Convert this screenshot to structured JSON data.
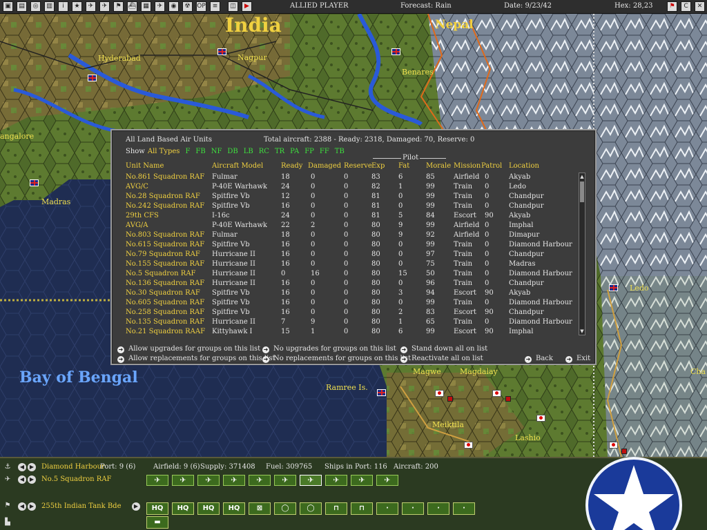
{
  "topbar": {
    "icons": [
      "layout-icon",
      "document-icon",
      "target-icon",
      "report-icon",
      "info-icon",
      "star-icon",
      "ship-icon",
      "plane-icon",
      "flag-icon",
      "warship-icon",
      "map-icon",
      "airfield-icon",
      "globe-icon",
      "radar-icon",
      "op-icon",
      "list-icon",
      "camera-icon",
      "end-turn-icon"
    ],
    "icon_glyphs": [
      "▣",
      "▤",
      "◎",
      "▥",
      "i",
      "★",
      "✈",
      "✈",
      "⚑",
      "⛴",
      "▦",
      "✈",
      "◉",
      "☢",
      "OP",
      "≡",
      "◫",
      "▶"
    ],
    "player": "ALLIED PLAYER",
    "forecast": "Forecast: Rain",
    "date": "Date: 9/23/42",
    "hex": "Hex: 28,23",
    "right_buttons": [
      "⚑",
      "C",
      "✕"
    ]
  },
  "map": {
    "labels": {
      "india": "India",
      "nepal": "Nepal",
      "hyderabad": "Hyderabad",
      "nagpur": "Nagpur",
      "benares": "Benares",
      "bangalore": "angalore",
      "madras": "Madras",
      "bay_of_bengal": "Bay of Bengal",
      "ramree": "Ramree Is.",
      "magwe": "Magwe",
      "magdalay": "Magdalay",
      "meiktila": "Meiktila",
      "lashio": "Lashio",
      "ledo": "Ledo",
      "cha": "Cha"
    }
  },
  "dialog": {
    "title": "All Land Based Air Units",
    "totals": "Total aircraft: 2388 - Ready: 2318, Damaged: 70, Reserve: 0",
    "show_label": "Show",
    "filters": [
      "All Types",
      "F",
      "FB",
      "NF",
      "DB",
      "LB",
      "RC",
      "TR",
      "PA",
      "FP",
      "FF",
      "TB"
    ],
    "pilot_header": "Pilot",
    "columns": [
      "Unit Name",
      "Aircraft Model",
      "Ready",
      "Damaged",
      "Reserve",
      "Exp",
      "Fat",
      "Morale",
      "Mission",
      "Patrol",
      "Location"
    ],
    "rows": [
      [
        "No.861 Squadron RAF",
        "Fulmar",
        "18",
        "0",
        "0",
        "83",
        "6",
        "85",
        "Airfield",
        "0",
        "Akyab"
      ],
      [
        "AVG/C",
        "P-40E Warhawk",
        "24",
        "0",
        "0",
        "82",
        "1",
        "99",
        "Train",
        "0",
        "Ledo"
      ],
      [
        "No.28 Squadron RAF",
        "Spitfire Vb",
        "12",
        "0",
        "0",
        "81",
        "0",
        "99",
        "Train",
        "0",
        "Chandpur"
      ],
      [
        "No.242 Squadron RAF",
        "Spitfire Vb",
        "16",
        "0",
        "0",
        "81",
        "0",
        "99",
        "Train",
        "0",
        "Chandpur"
      ],
      [
        "29th CFS",
        "I-16c",
        "24",
        "0",
        "0",
        "81",
        "5",
        "84",
        "Escort",
        "90",
        "Akyab"
      ],
      [
        "AVG/A",
        "P-40E Warhawk",
        "22",
        "2",
        "0",
        "80",
        "9",
        "99",
        "Airfield",
        "0",
        "Imphal"
      ],
      [
        "No.803 Squadron RAF",
        "Fulmar",
        "18",
        "0",
        "0",
        "80",
        "9",
        "92",
        "Airfield",
        "0",
        "Dimapur"
      ],
      [
        "No.615 Squadron RAF",
        "Spitfire Vb",
        "16",
        "0",
        "0",
        "80",
        "0",
        "99",
        "Train",
        "0",
        "Diamond Harbour"
      ],
      [
        "No.79 Squadron RAF",
        "Hurricane II",
        "16",
        "0",
        "0",
        "80",
        "0",
        "97",
        "Train",
        "0",
        "Chandpur"
      ],
      [
        "No.155 Squadron RAF",
        "Hurricane II",
        "16",
        "0",
        "0",
        "80",
        "0",
        "75",
        "Train",
        "0",
        "Madras"
      ],
      [
        "No.5 Squadron RAF",
        "Hurricane II",
        "0",
        "16",
        "0",
        "80",
        "15",
        "50",
        "Train",
        "0",
        "Diamond Harbour"
      ],
      [
        "No.136 Squadron RAF",
        "Hurricane II",
        "16",
        "0",
        "0",
        "80",
        "0",
        "96",
        "Train",
        "0",
        "Chandpur"
      ],
      [
        "No.30 Squadron RAF",
        "Spitfire Vb",
        "16",
        "0",
        "0",
        "80",
        "3",
        "94",
        "Escort",
        "90",
        "Akyab"
      ],
      [
        "No.605 Squadron RAF",
        "Spitfire Vb",
        "16",
        "0",
        "0",
        "80",
        "0",
        "99",
        "Train",
        "0",
        "Diamond Harbour"
      ],
      [
        "No.258 Squadron RAF",
        "Spitfire Vb",
        "16",
        "0",
        "0",
        "80",
        "2",
        "83",
        "Escort",
        "90",
        "Chandpur"
      ],
      [
        "No.135 Squadron RAF",
        "Hurricane II",
        "7",
        "9",
        "0",
        "80",
        "1",
        "65",
        "Train",
        "0",
        "Diamond Harbour"
      ],
      [
        "No.21 Squadron RAAF",
        "Kittyhawk I",
        "15",
        "1",
        "0",
        "80",
        "6",
        "99",
        "Escort",
        "90",
        "Imphal"
      ]
    ],
    "actions": {
      "allow_upgrades": "Allow upgrades for groups on this list",
      "allow_replacements": "Allow replacements for groups on this list",
      "no_upgrades": "No upgrades for groups on this list",
      "no_replacements": "No replacements for groups on this list",
      "stand_down": "Stand down all on list",
      "reactivate": "Reactivate all on list",
      "back": "Back",
      "exit": "Exit"
    }
  },
  "bottom": {
    "base_name": "Diamond Harbour",
    "port": "Port: 9 (6)",
    "airfield": "Airfield: 9 (6)",
    "supply": "Supply: 371408",
    "fuel": "Fuel: 309765",
    "ships_in_port": "Ships in Port: 116",
    "aircraft": "Aircraft: 200",
    "air_unit": "No.5 Squadron RAF",
    "land_unit": "255th Indian Tank Bde",
    "air_buttons": [
      "✈",
      "✈",
      "✈",
      "✈",
      "✈",
      "✈",
      "✈",
      "✈",
      "✈",
      "✈"
    ],
    "land_buttons": [
      "HQ",
      "HQ",
      "HQ",
      "HQ",
      "⊠",
      "◯",
      "◯",
      "⊓",
      "⊓",
      "·",
      "·",
      "·",
      "·"
    ],
    "tank_icon": "▬"
  },
  "colors": {
    "dialog_bg": "#3c3c3c",
    "highlight_yellow": "#f0d040",
    "filter_green": "#3ee03e",
    "ocean": "#1d2a4c",
    "land_green": "#4f6a2a",
    "mountain": "#8a96a6"
  }
}
